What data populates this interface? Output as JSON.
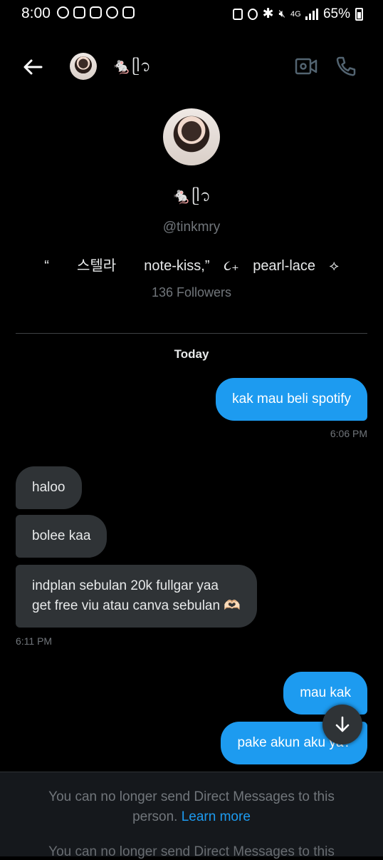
{
  "status_bar": {
    "time": "8:00",
    "network": "4G",
    "battery": "65%"
  },
  "header": {
    "name": "🐁ᥫ᭡"
  },
  "profile": {
    "name": "🐁ᥫ᭡",
    "handle": "@tinkmry",
    "bio": "“  스텔라  note-kiss,” ૮₊ pearl-lace ⟡",
    "followers": "136 Followers"
  },
  "date_divider": "Today",
  "messages": [
    {
      "text": "kak mau beli spotify",
      "direction": "out"
    },
    {
      "time": "6:06 PM"
    },
    {
      "text": "haloo",
      "direction": "in"
    },
    {
      "text": "bolee kaa",
      "direction": "in"
    },
    {
      "text": "indplan sebulan 20k fullgar yaa\nget free viu atau canva sebulan 🫶🏻",
      "direction": "in"
    },
    {
      "time": "6:11 PM"
    },
    {
      "text": "mau kak",
      "direction": "out"
    },
    {
      "text": "pake akun aku ya?",
      "direction": "out"
    }
  ],
  "footer": {
    "notice": "You can no longer send Direct Messages to this person.",
    "link": "Learn more",
    "ghost_text": "You can no longer send Direct Messages to this"
  },
  "colors": {
    "accent": "#1d9bf0",
    "incoming_bubble": "#2f3336",
    "background": "#000000"
  },
  "icons": [
    "back-arrow-icon",
    "video-call-icon",
    "phone-icon",
    "scroll-down-icon"
  ]
}
